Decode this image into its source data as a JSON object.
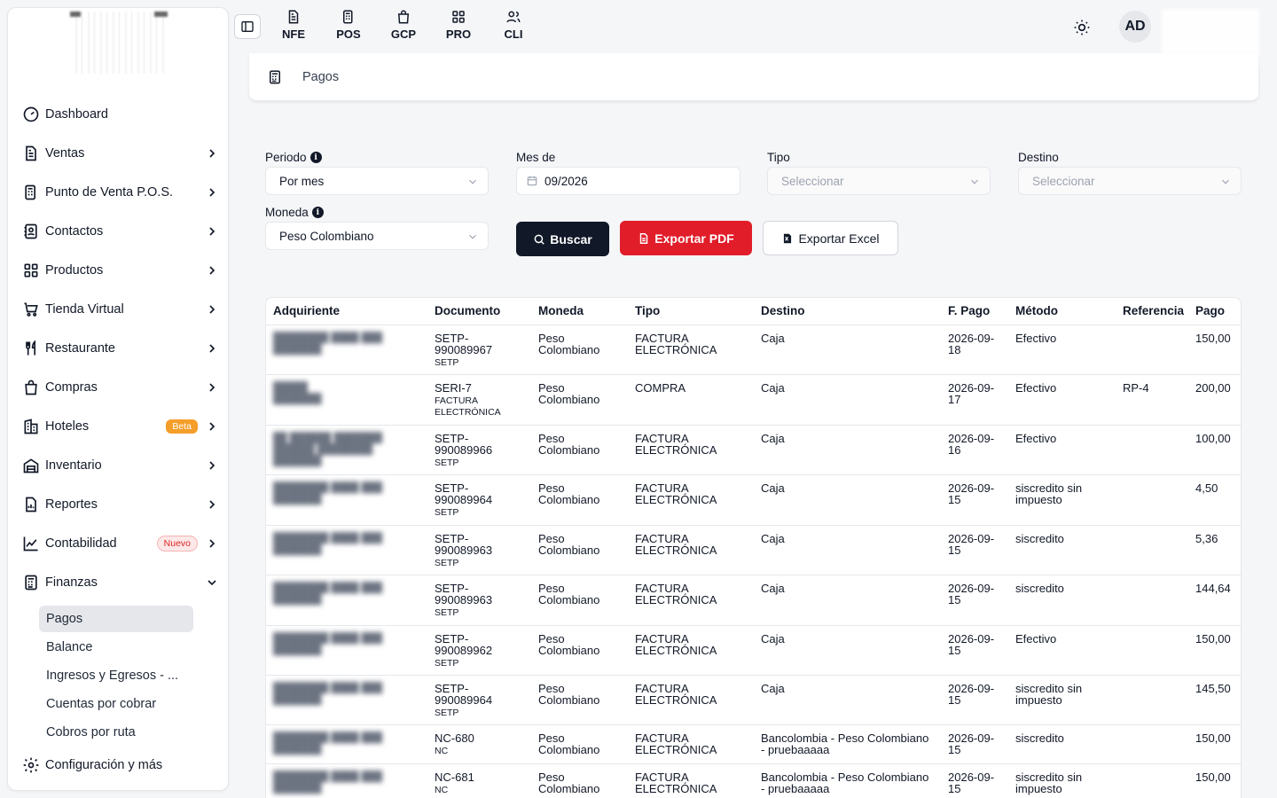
{
  "sidebar": {
    "items": [
      {
        "label": "Dashboard",
        "icon": "dashboard-icon",
        "chevron": false
      },
      {
        "label": "Ventas",
        "icon": "document-icon",
        "chevron": true
      },
      {
        "label": "Punto de Venta P.O.S.",
        "icon": "pos-icon",
        "chevron": true
      },
      {
        "label": "Contactos",
        "icon": "contacts-icon",
        "chevron": true
      },
      {
        "label": "Productos",
        "icon": "grid-icon",
        "chevron": true
      },
      {
        "label": "Tienda Virtual",
        "icon": "cart-icon",
        "chevron": true
      },
      {
        "label": "Restaurante",
        "icon": "utensils-icon",
        "chevron": true
      },
      {
        "label": "Compras",
        "icon": "bag-icon",
        "chevron": true
      },
      {
        "label": "Hoteles",
        "icon": "hotel-icon",
        "chevron": true,
        "badge": "Beta"
      },
      {
        "label": "Inventario",
        "icon": "warehouse-icon",
        "chevron": true
      },
      {
        "label": "Reportes",
        "icon": "report-icon",
        "chevron": true
      },
      {
        "label": "Contabilidad",
        "icon": "chart-icon",
        "chevron": true,
        "badge": "Nuevo"
      },
      {
        "label": "Finanzas",
        "icon": "calculator-icon",
        "chevron": "down"
      }
    ],
    "finanzas_sub": [
      "Pagos",
      "Balance",
      "Ingresos y Egresos - ...",
      "Cuentas por cobrar",
      "Cobros por ruta"
    ],
    "config_label": "Configuración y más"
  },
  "topbar": {
    "tabs": [
      {
        "label": "NFE",
        "icon": "invoice-icon"
      },
      {
        "label": "POS",
        "icon": "pos-icon"
      },
      {
        "label": "GCP",
        "icon": "bag-icon"
      },
      {
        "label": "PRO",
        "icon": "grid-icon"
      },
      {
        "label": "CLI",
        "icon": "users-icon"
      }
    ],
    "avatar": "AD"
  },
  "breadcrumb": {
    "label": "Pagos"
  },
  "filters": {
    "periodo_label": "Periodo",
    "periodo_value": "Por mes",
    "mes_label": "Mes de",
    "mes_value": "09/2026",
    "tipo_label": "Tipo",
    "tipo_placeholder": "Seleccionar",
    "destino_label": "Destino",
    "destino_placeholder": "Seleccionar",
    "moneda_label": "Moneda",
    "moneda_value": "Peso Colombiano",
    "info_glyph": "i"
  },
  "buttons": {
    "buscar": "Buscar",
    "pdf": "Exportar PDF",
    "excel": "Exportar Excel"
  },
  "table": {
    "headers": [
      "Adquiriente",
      "Documento",
      "Moneda",
      "Tipo",
      "Destino",
      "F. Pago",
      "Método",
      "Referencia",
      "Pago"
    ],
    "rows": [
      {
        "doc": "SETP-990089967",
        "doc_sub": "SETP",
        "moneda": "Peso Colombiano",
        "tipo": "FACTURA ELECTRÓNICA",
        "destino": "Caja",
        "fecha": "2026-09-18",
        "metodo": "Efectivo",
        "ref": "",
        "pago": "150,00"
      },
      {
        "doc": "SERI-7",
        "doc_sub": "FACTURA ELECTRÓNICA",
        "moneda": "Peso Colombiano",
        "tipo": "COMPRA",
        "destino": "Caja",
        "fecha": "2026-09-17",
        "metodo": "Efectivo",
        "ref": "RP-4",
        "pago": "200,00"
      },
      {
        "doc": "SETP-990089966",
        "doc_sub": "SETP",
        "moneda": "Peso Colombiano",
        "tipo": "FACTURA ELECTRÓNICA",
        "destino": "Caja",
        "fecha": "2026-09-16",
        "metodo": "Efectivo",
        "ref": "",
        "pago": "100,00"
      },
      {
        "doc": "SETP-990089964",
        "doc_sub": "SETP",
        "moneda": "Peso Colombiano",
        "tipo": "FACTURA ELECTRÓNICA",
        "destino": "Caja",
        "fecha": "2026-09-15",
        "metodo": "siscredito sin impuesto",
        "ref": "",
        "pago": "4,50"
      },
      {
        "doc": "SETP-990089963",
        "doc_sub": "SETP",
        "moneda": "Peso Colombiano",
        "tipo": "FACTURA ELECTRÓNICA",
        "destino": "Caja",
        "fecha": "2026-09-15",
        "metodo": "siscredito",
        "ref": "",
        "pago": "5,36"
      },
      {
        "doc": "SETP-990089963",
        "doc_sub": "SETP",
        "moneda": "Peso Colombiano",
        "tipo": "FACTURA ELECTRÓNICA",
        "destino": "Caja",
        "fecha": "2026-09-15",
        "metodo": "siscredito",
        "ref": "",
        "pago": "144,64"
      },
      {
        "doc": "SETP-990089962",
        "doc_sub": "SETP",
        "moneda": "Peso Colombiano",
        "tipo": "FACTURA ELECTRÓNICA",
        "destino": "Caja",
        "fecha": "2026-09-15",
        "metodo": "Efectivo",
        "ref": "",
        "pago": "150,00"
      },
      {
        "doc": "SETP-990089964",
        "doc_sub": "SETP",
        "moneda": "Peso Colombiano",
        "tipo": "FACTURA ELECTRÓNICA",
        "destino": "Caja",
        "fecha": "2026-09-15",
        "metodo": "siscredito sin impuesto",
        "ref": "",
        "pago": "145,50"
      },
      {
        "doc": "NC-680",
        "doc_sub": "NC",
        "moneda": "Peso Colombiano",
        "tipo": "FACTURA ELECTRÓNICA",
        "destino": "Bancolombia - Peso Colombiano - pruebaaaaa",
        "fecha": "2026-09-15",
        "metodo": "siscredito",
        "ref": "",
        "pago": "150,00"
      },
      {
        "doc": "NC-681",
        "doc_sub": "NC",
        "moneda": "Peso Colombiano",
        "tipo": "FACTURA ELECTRÓNICA",
        "destino": "Bancolombia - Peso Colombiano - pruebaaaaa",
        "fecha": "2026-09-15",
        "metodo": "siscredito sin impuesto",
        "ref": "",
        "pago": "150,00"
      }
    ]
  },
  "colors": {
    "primary": "#111827",
    "danger": "#e11d2a",
    "beta": "#f59e2a",
    "active_bg": "#e5e7eb"
  }
}
